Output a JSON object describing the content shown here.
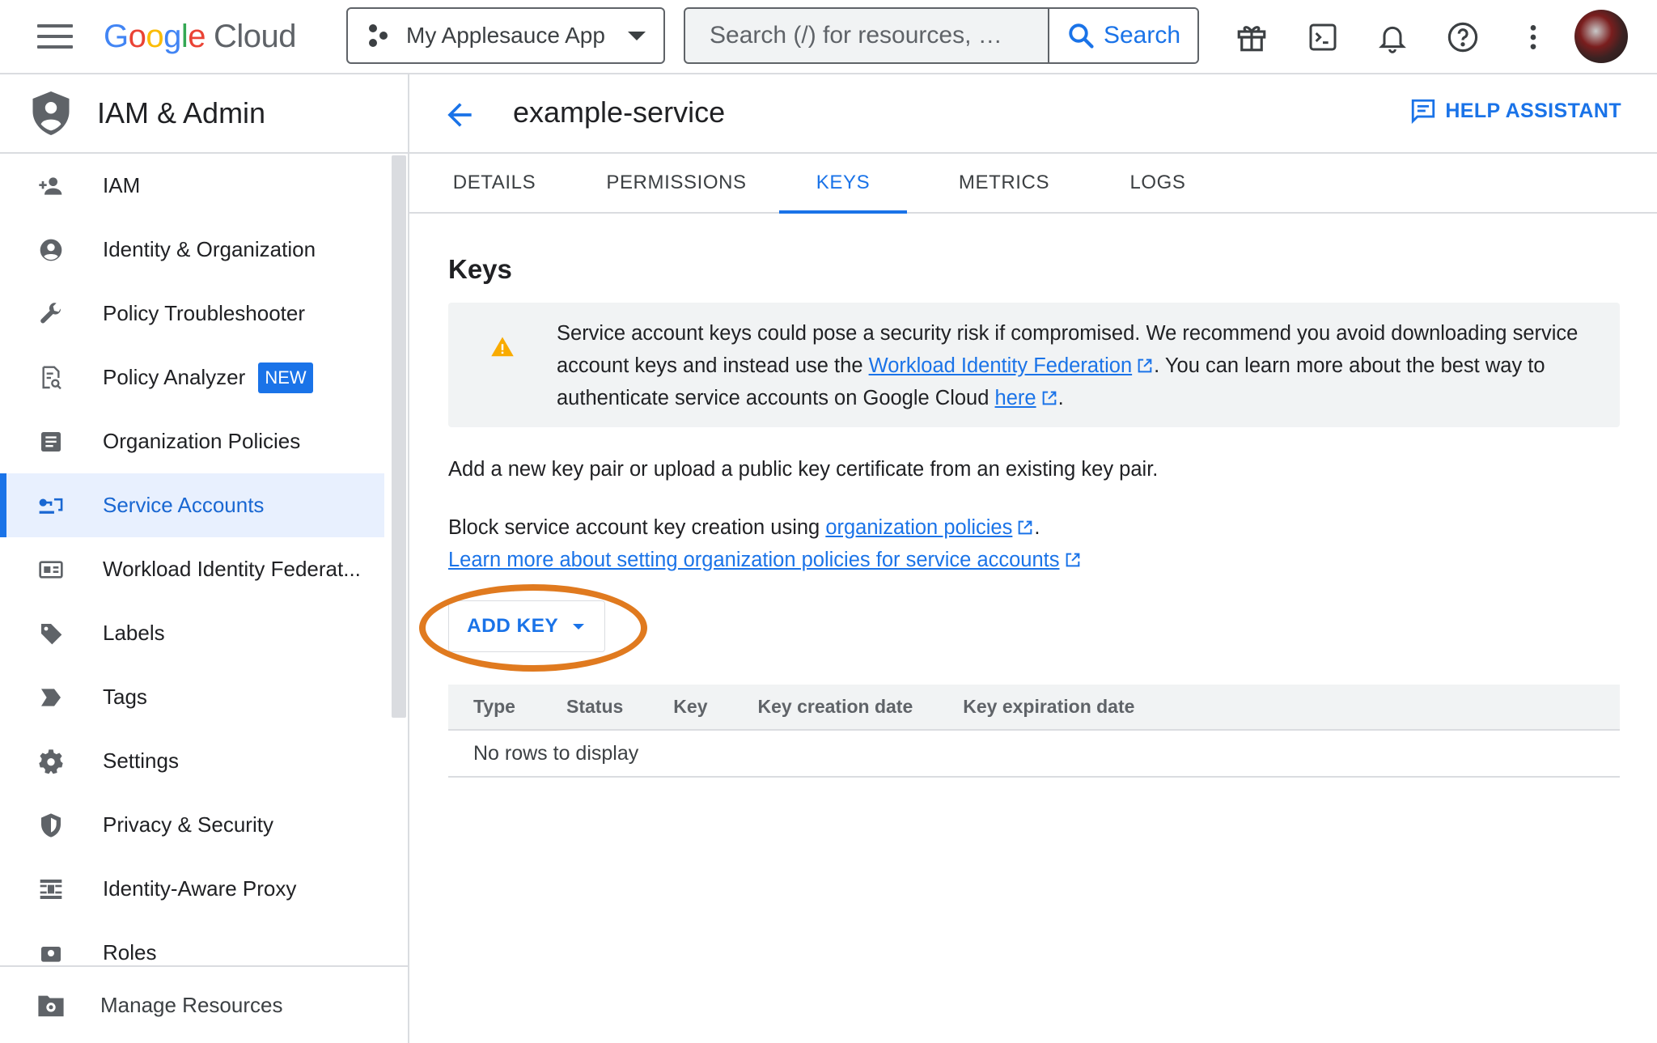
{
  "topbar": {
    "logo_letters": [
      "G",
      "o",
      "o",
      "g",
      "l",
      "e"
    ],
    "logo_cloud": "Cloud",
    "project_name": "My Applesauce App",
    "search_placeholder": "Search (/) for resources, …",
    "search_label": "Search",
    "icons": [
      "gift-icon",
      "terminal-icon",
      "bell-icon",
      "help-icon",
      "more-vert-icon"
    ]
  },
  "sidenav": {
    "title": "IAM & Admin",
    "items": [
      {
        "label": "IAM",
        "icon": "person-add-icon"
      },
      {
        "label": "Identity & Organization",
        "icon": "account-circle-icon"
      },
      {
        "label": "Policy Troubleshooter",
        "icon": "wrench-icon"
      },
      {
        "label": "Policy Analyzer",
        "icon": "policy-analyzer-icon",
        "badge": "NEW"
      },
      {
        "label": "Organization Policies",
        "icon": "document-icon"
      },
      {
        "label": "Service Accounts",
        "icon": "service-account-icon",
        "active": true
      },
      {
        "label": "Workload Identity Federat...",
        "icon": "id-card-icon"
      },
      {
        "label": "Labels",
        "icon": "label-icon"
      },
      {
        "label": "Tags",
        "icon": "tag-icon"
      },
      {
        "label": "Settings",
        "icon": "gear-icon"
      },
      {
        "label": "Privacy & Security",
        "icon": "shield-icon"
      },
      {
        "label": "Identity-Aware Proxy",
        "icon": "proxy-icon"
      },
      {
        "label": "Roles",
        "icon": "roles-icon"
      }
    ],
    "footer_label": "Manage Resources"
  },
  "page": {
    "title": "example-service",
    "help_label": "HELP ASSISTANT",
    "tabs": [
      "DETAILS",
      "PERMISSIONS",
      "KEYS",
      "METRICS",
      "LOGS"
    ],
    "active_tab": "KEYS"
  },
  "keys": {
    "section_title": "Keys",
    "warning": {
      "part1": "Service account keys could pose a security risk if compromised. We recommend you avoid downloading service account keys and instead use the ",
      "link1": "Workload Identity Federation",
      "part2": ". You can learn more about the best way to authenticate service accounts on Google Cloud ",
      "link2": "here",
      "part3": "."
    },
    "description": "Add a new key pair or upload a public key certificate from an existing key pair.",
    "block_text": "Block service account key creation using ",
    "block_link": "organization policies",
    "block_end": ".",
    "learn_more_link": "Learn more about setting organization policies for service accounts",
    "add_key_label": "ADD KEY",
    "table": {
      "columns": [
        "Type",
        "Status",
        "Key",
        "Key creation date",
        "Key expiration date"
      ],
      "empty_text": "No rows to display"
    }
  },
  "colors": {
    "accent": "#1a73e8",
    "highlight_ring": "#e07a1f",
    "warning": "#f9ab00"
  }
}
